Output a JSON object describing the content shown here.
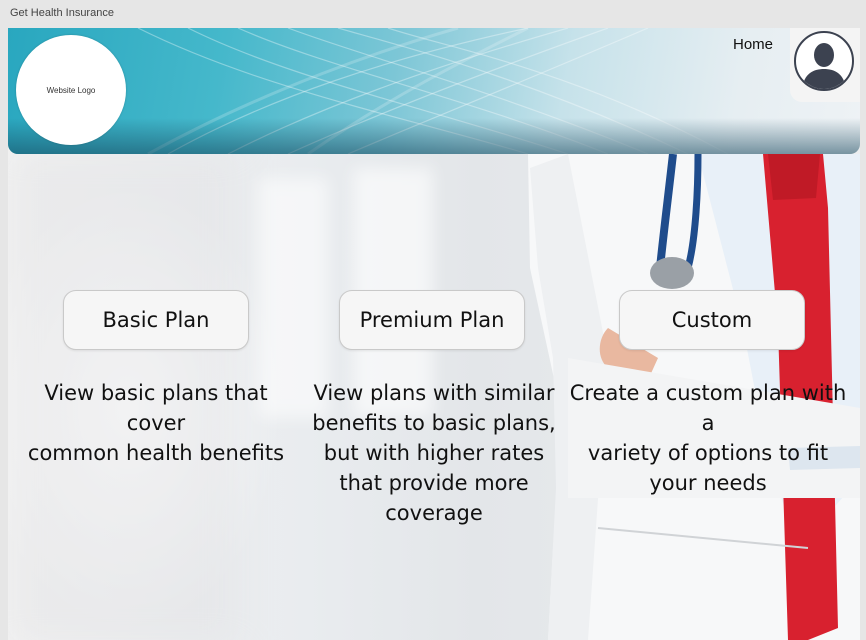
{
  "window": {
    "title": "Get Health Insurance"
  },
  "header": {
    "logo_text": "Website Logo",
    "nav": {
      "home_label": "Home"
    },
    "avatar_icon": "user-silhouette-icon"
  },
  "plans": [
    {
      "label": "Basic Plan",
      "description": "View basic plans that cover\ncommon health benefits"
    },
    {
      "label": "Premium Plan",
      "description": "View plans with similar\nbenefits to basic plans,\nbut with higher rates\nthat provide more coverage"
    },
    {
      "label": "Custom",
      "description": "Create a custom plan with a\nvariety of options to fit\nyour needs"
    }
  ],
  "colors": {
    "header_teal": "#29a7bf",
    "tie_red": "#d8212f",
    "button_bg": "#f6f6f6"
  }
}
